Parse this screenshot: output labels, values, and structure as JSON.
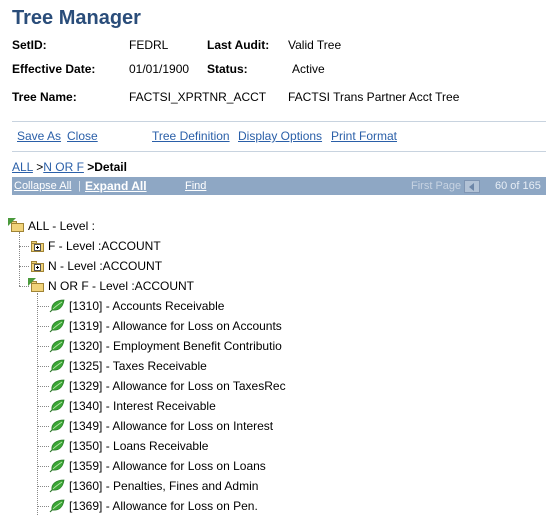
{
  "page": {
    "title": "Tree Manager"
  },
  "header": {
    "setid_label": "SetID:",
    "setid_value": "FEDRL",
    "last_audit_label": "Last Audit:",
    "last_audit_value": "Valid Tree",
    "effdate_label": "Effective Date:",
    "effdate_value": "01/01/1900",
    "status_label": "Status:",
    "status_value": "Active",
    "treename_label": "Tree Name:",
    "treename_value": "FACTSI_XPRTNR_ACCT",
    "treename_desc": "FACTSI Trans Partner Acct Tree"
  },
  "actions": {
    "save_as": "Save As",
    "close": "Close",
    "tree_definition": "Tree Definition",
    "display_options": "Display Options",
    "print_format": "Print Format"
  },
  "breadcrumb": {
    "all": "ALL",
    "sep1": " >",
    "norf": "N OR F",
    "sep2": " >",
    "detail": "Detail"
  },
  "navbar": {
    "collapse_all": "Collapse All",
    "expand_all": "Expand All",
    "find": "Find",
    "first_page": "First Page",
    "count": "60 of 165"
  },
  "tree": {
    "root": "ALL -    Level :",
    "nodes": [
      {
        "label": "F -    Level :ACCOUNT",
        "state": "collapsed"
      },
      {
        "label": "N -    Level :ACCOUNT",
        "state": "collapsed"
      },
      {
        "label": "N OR F -    Level :ACCOUNT",
        "state": "expanded"
      }
    ],
    "leaves": [
      "[1310] - Accounts Receivable",
      "[1319] - Allowance for Loss on Accounts",
      "[1320] - Employment Benefit Contributio",
      "[1325] - Taxes Receivable",
      "[1329] - Allowance for Loss on TaxesRec",
      "[1340] - Interest Receivable",
      "[1349] - Allowance for Loss on Interest",
      "[1350] - Loans Receivable",
      "[1359] - Allowance for Loss on Loans",
      "[1360] - Penalties, Fines and Admin",
      "[1369] - Allowance for Loss on Pen."
    ]
  },
  "colors": {
    "title": "#2a4d7a",
    "link": "#2a5fa8",
    "navbar": "#8ea7c4",
    "leaf": "#3aa635"
  }
}
